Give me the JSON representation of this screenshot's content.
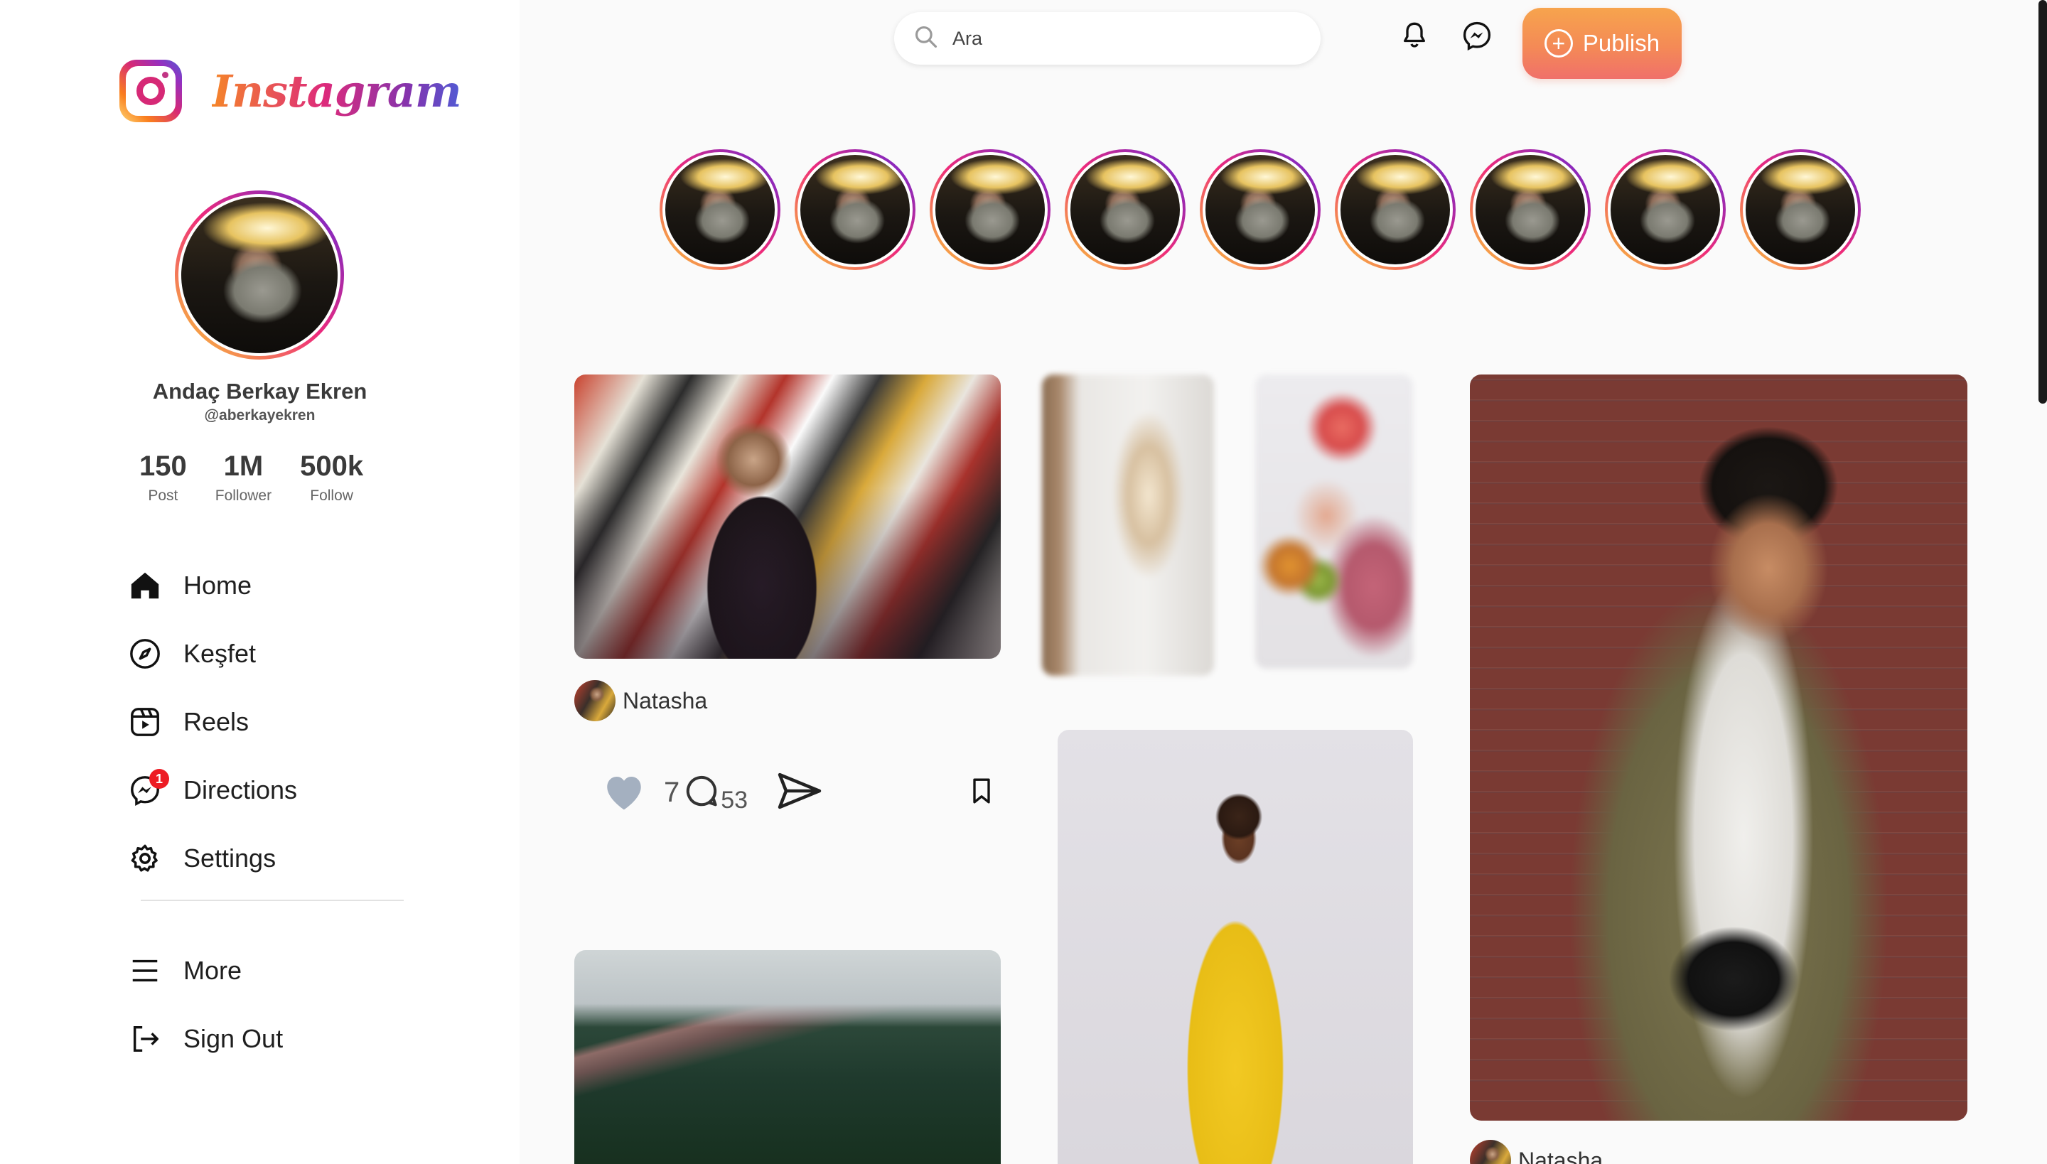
{
  "brand": {
    "wordmark": "Instagram"
  },
  "profile": {
    "name": "Andaç Berkay Ekren",
    "handle": "@aberkayekren",
    "stats": [
      {
        "value": "150",
        "label": "Post"
      },
      {
        "value": "1M",
        "label": "Follower"
      },
      {
        "value": "500k",
        "label": "Follow"
      }
    ]
  },
  "nav": {
    "items": [
      {
        "label": "Home",
        "icon": "home-icon"
      },
      {
        "label": "Keşfet",
        "icon": "compass-icon"
      },
      {
        "label": "Reels",
        "icon": "reels-icon"
      },
      {
        "label": "Directions",
        "icon": "messenger-icon",
        "badge": "1"
      },
      {
        "label": "Settings",
        "icon": "gear-icon"
      }
    ],
    "bottom": [
      {
        "label": "More",
        "icon": "menu-icon"
      },
      {
        "label": "Sign Out",
        "icon": "sign-out-icon"
      }
    ]
  },
  "search": {
    "placeholder": "Ara"
  },
  "topbar": {
    "publish_label": "Publish",
    "icons": [
      "bell-icon",
      "messenger-icon"
    ]
  },
  "stories": {
    "count": 9
  },
  "posts": [
    {
      "author": "Natasha",
      "likes": "7",
      "comments": "53"
    },
    {
      "author": "Natasha"
    }
  ],
  "colors": {
    "publish_gradient_top": "#f7a44d",
    "publish_gradient_bottom": "#f0706a",
    "badge": "#ed1c24",
    "heart": "#a4b0c0"
  }
}
